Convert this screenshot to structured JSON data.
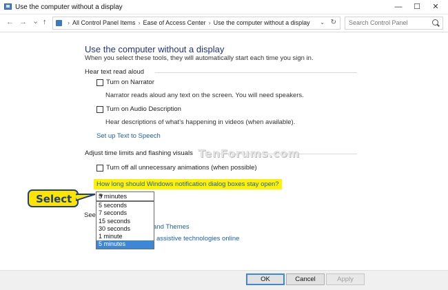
{
  "window": {
    "title": "Use the computer without a display",
    "minimize": "—",
    "maximize": "☐",
    "close": "✕"
  },
  "nav": {
    "back": "←",
    "forward": "→",
    "recent": "⌄",
    "up": "↑",
    "breadcrumbs": [
      "All Control Panel Items",
      "Ease of Access Center",
      "Use the computer without a display"
    ],
    "separator": "›",
    "dropdown": "⌄",
    "refresh": "↻",
    "search_placeholder": "Search Control Panel"
  },
  "main": {
    "heading": "Use the computer without a display",
    "subtitle": "When you select these tools, they will automatically start each time you sign in.",
    "sections": {
      "read_aloud": {
        "label": "Hear text read aloud",
        "narrator_label": "Turn on Narrator",
        "narrator_desc": "Narrator reads aloud any text on the screen. You will need speakers.",
        "audio_label": "Turn on Audio Description",
        "audio_desc": "Hear descriptions of what's happening in videos (when available).",
        "tts_link": "Set up Text to Speech"
      },
      "time_limits": {
        "label": "Adjust time limits and flashing visuals",
        "animations_label": "Turn off all unnecessary animations (when possible)",
        "question": "How long should Windows notification dialog boxes stay open?",
        "selected": "5 minutes",
        "options": [
          "5 seconds",
          "7 seconds",
          "15 seconds",
          "30 seconds",
          "1 minute",
          "5 minutes"
        ]
      },
      "see_also": {
        "label_partial": "See",
        "link1_partial": "and Themes",
        "link2_partial": "assistive technologies online"
      }
    }
  },
  "callout": {
    "text": "Select"
  },
  "watermark": "TenForums.com",
  "footer": {
    "ok": "OK",
    "cancel": "Cancel",
    "apply": "Apply"
  }
}
